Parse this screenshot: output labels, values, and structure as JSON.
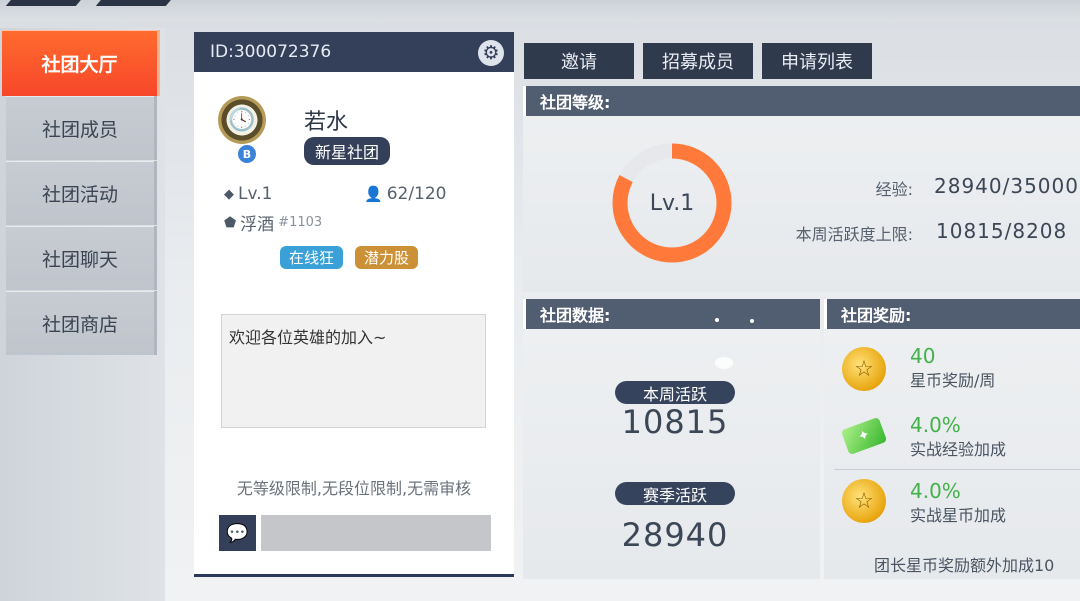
{
  "nav": {
    "items": [
      {
        "label": "社团大厅",
        "active": true
      },
      {
        "label": "社团成员"
      },
      {
        "label": "社团活动"
      },
      {
        "label": "社团聊天"
      },
      {
        "label": "社团商店"
      }
    ]
  },
  "profile": {
    "id_text": "ID:300072376",
    "club_name": "若水",
    "club_tag": "新星社团",
    "emblem_badge": "B",
    "level": "Lv.1",
    "members": "62/120",
    "leader_name": "浮酒",
    "leader_suffix": "#1103",
    "tags": [
      "在线狂",
      "潜力股"
    ],
    "intro": "欢迎各位英雄的加入~",
    "limits": "无等级限制,无段位限制,无需审核",
    "chat_placeholder": ""
  },
  "top_buttons": [
    "邀请",
    "招募成员",
    "申请列表"
  ],
  "level_panel": {
    "title": "社团等级:",
    "ring_label": "Lv.1",
    "exp_label": "经验:",
    "exp_value": "28940/35000",
    "weekly_cap_label": "本周活跃度上限:",
    "weekly_cap_value": "10815/8208",
    "ring_progress": 0.827
  },
  "data_panel": {
    "title": "社团数据:",
    "weekly_label": "本周活跃",
    "weekly_value": "10815",
    "season_label": "赛季活跃",
    "season_value": "28940"
  },
  "reward_panel": {
    "title": "社团奖励:",
    "items": [
      {
        "value": "40",
        "desc": "星币奖励/周",
        "icon": "star-coin-icon"
      },
      {
        "value": "4.0%",
        "desc": "实战经验加成",
        "icon": "exp-ticket-icon"
      },
      {
        "value": "4.0%",
        "desc": "实战星币加成",
        "icon": "star-coin-icon"
      }
    ],
    "footnote": "团长星币奖励额外加成10"
  },
  "colors": {
    "accent": "#f7472a",
    "navy": "#34405a",
    "ring": "#ff7a3a",
    "green": "#42b14a"
  }
}
